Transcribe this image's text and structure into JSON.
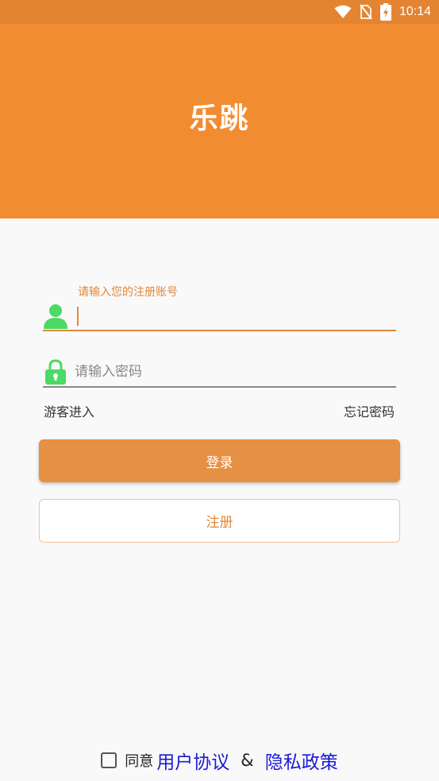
{
  "status_bar": {
    "time": "10:14",
    "icons": [
      "wifi-icon",
      "no-sim-icon",
      "battery-charging-icon"
    ]
  },
  "header": {
    "logo_text": "乐跳",
    "background": "#f28c30"
  },
  "login_form": {
    "account_label": "请输入您的注册账号",
    "account_value": "",
    "account_icon": "user-icon",
    "password_placeholder": "请输入密码",
    "password_value": "",
    "password_icon": "lock-icon",
    "guest_link": "游客进入",
    "forgot_link": "忘记密码",
    "login_button": "登录",
    "register_button": "注册"
  },
  "agreement": {
    "checked": false,
    "prefix": "同意",
    "user_agreement": "用户协议",
    "separator": "&",
    "privacy_policy": "隐私政策"
  },
  "colors": {
    "accent": "#e69043",
    "icon_green": "#4cd964",
    "link_blue": "#1a1ad6"
  }
}
